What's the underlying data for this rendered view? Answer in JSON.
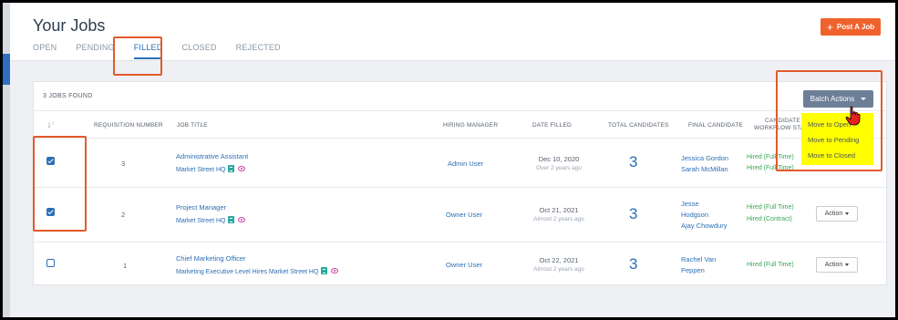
{
  "page": {
    "title": "Your Jobs",
    "post_button": "Post A Job",
    "tabs": [
      {
        "label": "OPEN"
      },
      {
        "label": "PENDING"
      },
      {
        "label": "FILLED"
      },
      {
        "label": "CLOSED"
      },
      {
        "label": "REJECTED"
      }
    ],
    "active_tab": "FILLED"
  },
  "toolbar": {
    "jobs_found": "3 JOBS FOUND",
    "batch_actions": "Batch Actions",
    "batch_menu": [
      "Move to Open",
      "Move to Pending",
      "Move to Closed"
    ]
  },
  "table": {
    "headers": {
      "requisition": "REQUISITION NUMBER",
      "job_title": "JOB TITLE",
      "hiring_manager": "HIRING MANAGER",
      "date_filled": "DATE FILLED",
      "total_candidates": "TOTAL CANDIDATES",
      "final_candidate": "FINAL CANDIDATE",
      "workflow_line1": "CANDIDATE",
      "workflow_line2": "WORKFLOW STATU"
    },
    "rows": [
      {
        "checked": true,
        "requisition": "3",
        "title": "Administrative Assistant",
        "location": "Market Street HQ",
        "manager": "Admin User",
        "date": "Dec 10, 2020",
        "ago": "Over 2 years ago",
        "total": "3",
        "candidates": [
          "Jessica Gordon",
          "Sarah McMillan"
        ],
        "statuses": [
          "Hired (Full Time)",
          "Hired (Full Time)"
        ],
        "action": "Action"
      },
      {
        "checked": true,
        "requisition": "2",
        "title": "Project Manager",
        "location": "Market Street HQ",
        "manager": "Owner User",
        "date": "Oct 21, 2021",
        "ago": "Almost 2 years ago",
        "total": "3",
        "candidates": [
          "Jesse",
          "Hodgson",
          "Ajay Chowdury"
        ],
        "statuses": [
          "Hired (Full Time)",
          "Hired (Contract)"
        ],
        "action": "Action"
      },
      {
        "checked": false,
        "requisition": "1",
        "title": "Chief Marketing Officer",
        "location": "Marketing Executive Level Hires Market Street HQ",
        "manager": "Owner User",
        "date": "Oct 22, 2021",
        "ago": "Almost 2 years ago",
        "total": "3",
        "candidates": [
          "Rachel Van",
          "Peppen"
        ],
        "statuses": [
          "Hired (Full Time)"
        ],
        "action": "Action"
      }
    ]
  },
  "colors": {
    "accent": "#2c6fb5",
    "post_button": "#f0622d",
    "highlight": "#e35b2a",
    "menu_bg": "#ffff00",
    "status_green": "#3aa655"
  }
}
